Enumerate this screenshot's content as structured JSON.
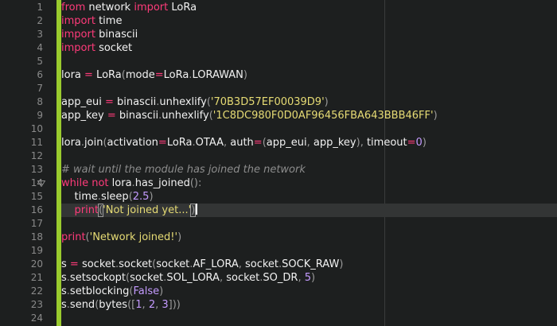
{
  "editor": {
    "line_numbers": [
      "1",
      "2",
      "3",
      "4",
      "5",
      "6",
      "7",
      "8",
      "9",
      "10",
      "11",
      "12",
      "13",
      "14",
      "15",
      "16",
      "17",
      "18",
      "19",
      "20",
      "21",
      "22",
      "23",
      "24"
    ],
    "lines": [
      [
        {
          "t": "from",
          "c": "kw"
        },
        {
          "t": " network ",
          "c": ""
        },
        {
          "t": "import",
          "c": "kw"
        },
        {
          "t": " LoRa",
          "c": ""
        }
      ],
      [
        {
          "t": "import",
          "c": "kw"
        },
        {
          "t": " time",
          "c": ""
        }
      ],
      [
        {
          "t": "import",
          "c": "kw"
        },
        {
          "t": " binascii",
          "c": ""
        }
      ],
      [
        {
          "t": "import",
          "c": "kw"
        },
        {
          "t": " socket",
          "c": ""
        }
      ],
      [],
      [
        {
          "t": "lora ",
          "c": ""
        },
        {
          "t": "=",
          "c": "op"
        },
        {
          "t": " LoRa",
          "c": ""
        },
        {
          "t": "(",
          "c": "dim"
        },
        {
          "t": "mode",
          "c": ""
        },
        {
          "t": "=",
          "c": "op"
        },
        {
          "t": "LoRa",
          "c": ""
        },
        {
          "t": ".",
          "c": "dim"
        },
        {
          "t": "LORAWAN",
          "c": ""
        },
        {
          "t": ")",
          "c": "dim"
        }
      ],
      [],
      [
        {
          "t": "app_eui ",
          "c": ""
        },
        {
          "t": "=",
          "c": "op"
        },
        {
          "t": " binascii",
          "c": ""
        },
        {
          "t": ".",
          "c": "dim"
        },
        {
          "t": "unhexlify",
          "c": ""
        },
        {
          "t": "(",
          "c": "dim"
        },
        {
          "t": "'70B3D57EF00039D9'",
          "c": "str"
        },
        {
          "t": ")",
          "c": "dim"
        }
      ],
      [
        {
          "t": "app_key ",
          "c": ""
        },
        {
          "t": "=",
          "c": "op"
        },
        {
          "t": " binascii",
          "c": ""
        },
        {
          "t": ".",
          "c": "dim"
        },
        {
          "t": "unhexlify",
          "c": ""
        },
        {
          "t": "(",
          "c": "dim"
        },
        {
          "t": "'1C8DC980F0D0AF96456FBA643BBB46FF'",
          "c": "str"
        },
        {
          "t": ")",
          "c": "dim"
        }
      ],
      [],
      [
        {
          "t": "lora",
          "c": ""
        },
        {
          "t": ".",
          "c": "dim"
        },
        {
          "t": "join",
          "c": ""
        },
        {
          "t": "(",
          "c": "dim"
        },
        {
          "t": "activation",
          "c": ""
        },
        {
          "t": "=",
          "c": "op"
        },
        {
          "t": "LoRa",
          "c": ""
        },
        {
          "t": ".",
          "c": "dim"
        },
        {
          "t": "OTAA",
          "c": ""
        },
        {
          "t": ",",
          "c": "dim"
        },
        {
          "t": " auth",
          "c": ""
        },
        {
          "t": "=",
          "c": "op"
        },
        {
          "t": "(",
          "c": "dim"
        },
        {
          "t": "app_eui",
          "c": ""
        },
        {
          "t": ",",
          "c": "dim"
        },
        {
          "t": " app_key",
          "c": ""
        },
        {
          "t": ")",
          "c": "dim"
        },
        {
          "t": ",",
          "c": "dim"
        },
        {
          "t": " timeout",
          "c": ""
        },
        {
          "t": "=",
          "c": "op"
        },
        {
          "t": "0",
          "c": "num"
        },
        {
          "t": ")",
          "c": "dim"
        }
      ],
      [],
      [
        {
          "t": "# wait until the module has joined the network",
          "c": "cm"
        }
      ],
      [
        {
          "t": "while",
          "c": "kw"
        },
        {
          "t": " ",
          "c": ""
        },
        {
          "t": "not",
          "c": "kw"
        },
        {
          "t": " lora",
          "c": ""
        },
        {
          "t": ".",
          "c": "dim"
        },
        {
          "t": "has_joined",
          "c": ""
        },
        {
          "t": "():",
          "c": "dim"
        }
      ],
      [
        {
          "t": "    time",
          "c": ""
        },
        {
          "t": ".",
          "c": "dim"
        },
        {
          "t": "sleep",
          "c": ""
        },
        {
          "t": "(",
          "c": "dim"
        },
        {
          "t": "2.5",
          "c": "num"
        },
        {
          "t": ")",
          "c": "dim"
        }
      ],
      [
        {
          "t": "    ",
          "c": ""
        },
        {
          "t": "print",
          "c": "kw"
        },
        {
          "t": "(",
          "c": "dim bracket-hl"
        },
        {
          "t": "'Not joined yet...'",
          "c": "str"
        },
        {
          "t": ")",
          "c": "dim bracket-hl"
        }
      ],
      [],
      [
        {
          "t": "print",
          "c": "kw"
        },
        {
          "t": "(",
          "c": "dim"
        },
        {
          "t": "'Network joined!'",
          "c": "str"
        },
        {
          "t": ")",
          "c": "dim"
        }
      ],
      [],
      [
        {
          "t": "s ",
          "c": ""
        },
        {
          "t": "=",
          "c": "op"
        },
        {
          "t": " socket",
          "c": ""
        },
        {
          "t": ".",
          "c": "dim"
        },
        {
          "t": "socket",
          "c": ""
        },
        {
          "t": "(",
          "c": "dim"
        },
        {
          "t": "socket",
          "c": ""
        },
        {
          "t": ".",
          "c": "dim"
        },
        {
          "t": "AF_LORA",
          "c": ""
        },
        {
          "t": ",",
          "c": "dim"
        },
        {
          "t": " socket",
          "c": ""
        },
        {
          "t": ".",
          "c": "dim"
        },
        {
          "t": "SOCK_RAW",
          "c": ""
        },
        {
          "t": ")",
          "c": "dim"
        }
      ],
      [
        {
          "t": "s",
          "c": ""
        },
        {
          "t": ".",
          "c": "dim"
        },
        {
          "t": "setsockopt",
          "c": ""
        },
        {
          "t": "(",
          "c": "dim"
        },
        {
          "t": "socket",
          "c": ""
        },
        {
          "t": ".",
          "c": "dim"
        },
        {
          "t": "SOL_LORA",
          "c": ""
        },
        {
          "t": ",",
          "c": "dim"
        },
        {
          "t": " socket",
          "c": ""
        },
        {
          "t": ".",
          "c": "dim"
        },
        {
          "t": "SO_DR",
          "c": ""
        },
        {
          "t": ",",
          "c": "dim"
        },
        {
          "t": " ",
          "c": ""
        },
        {
          "t": "5",
          "c": "num"
        },
        {
          "t": ")",
          "c": "dim"
        }
      ],
      [
        {
          "t": "s",
          "c": ""
        },
        {
          "t": ".",
          "c": "dim"
        },
        {
          "t": "setblocking",
          "c": ""
        },
        {
          "t": "(",
          "c": "dim"
        },
        {
          "t": "False",
          "c": "num"
        },
        {
          "t": ")",
          "c": "dim"
        }
      ],
      [
        {
          "t": "s",
          "c": ""
        },
        {
          "t": ".",
          "c": "dim"
        },
        {
          "t": "send",
          "c": ""
        },
        {
          "t": "(",
          "c": "dim"
        },
        {
          "t": "bytes",
          "c": ""
        },
        {
          "t": "([",
          "c": "dim"
        },
        {
          "t": "1",
          "c": "num"
        },
        {
          "t": ",",
          "c": "dim"
        },
        {
          "t": " ",
          "c": ""
        },
        {
          "t": "2",
          "c": "num"
        },
        {
          "t": ",",
          "c": "dim"
        },
        {
          "t": " ",
          "c": ""
        },
        {
          "t": "3",
          "c": "num"
        },
        {
          "t": "]))",
          "c": "dim"
        }
      ],
      []
    ],
    "current_line": 16,
    "fold_marker_line": 14,
    "colors": {
      "background": "#1d1f1f",
      "change_bar": "#9acb2e",
      "keyword": "#ff3b7a",
      "string": "#e6db74",
      "number": "#c49bff",
      "comment": "#8c8c8c",
      "line_number": "#8a8a8a"
    },
    "icons": {
      "fold": "fold-triangle-icon"
    }
  }
}
